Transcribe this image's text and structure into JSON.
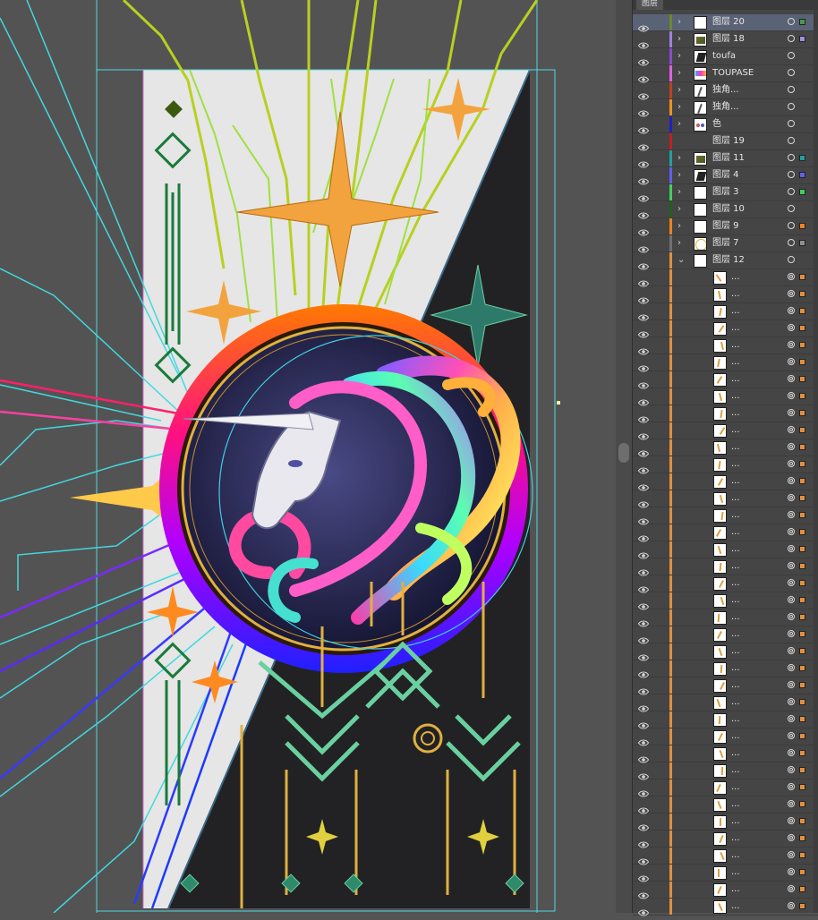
{
  "panel": {
    "tab_label": "图层"
  },
  "layers": [
    {
      "name": "图层 20",
      "color": "#6a8a2a",
      "expandable": true,
      "selected": true,
      "thumb": "white",
      "target": "single",
      "selbox": "#4a9a4a"
    },
    {
      "name": "图层 18",
      "color": "#a080e0",
      "expandable": true,
      "selected": false,
      "thumb": "art",
      "target": "single",
      "selbox": "#a090e0"
    },
    {
      "name": "toufa",
      "color": "#8a4ad0",
      "expandable": true,
      "selected": false,
      "thumb": "dark",
      "target": "single",
      "selbox": ""
    },
    {
      "name": "TOUPASE",
      "color": "#e060e0",
      "expandable": true,
      "selected": false,
      "thumb": "rainbow",
      "target": "single",
      "selbox": ""
    },
    {
      "name": "独角...",
      "color": "#c04020",
      "expandable": true,
      "selected": false,
      "thumb": "sketch",
      "target": "single",
      "selbox": ""
    },
    {
      "name": "独角...",
      "color": "#f09020",
      "expandable": true,
      "selected": false,
      "thumb": "sketch",
      "target": "single",
      "selbox": ""
    },
    {
      "name": "色",
      "color": "#2020c0",
      "expandable": true,
      "selected": false,
      "thumb": "dots",
      "target": "single",
      "selbox": ""
    },
    {
      "name": "图层 19",
      "color": "#c02020",
      "expandable": false,
      "selected": false,
      "thumb": "none",
      "target": "single",
      "selbox": ""
    },
    {
      "name": "图层 11",
      "color": "#20a0a0",
      "expandable": true,
      "selected": false,
      "thumb": "art",
      "target": "single",
      "selbox": "#20a0a0"
    },
    {
      "name": "图层 4",
      "color": "#6060f0",
      "expandable": true,
      "selected": false,
      "thumb": "dark",
      "target": "single",
      "selbox": "#6060f0"
    },
    {
      "name": "图层 3",
      "color": "#40d060",
      "expandable": true,
      "selected": false,
      "thumb": "white",
      "target": "single",
      "selbox": "#40d060"
    },
    {
      "name": "图层 10",
      "color": "#206020",
      "expandable": true,
      "selected": false,
      "thumb": "white",
      "target": "single",
      "selbox": ""
    },
    {
      "name": "图层 9",
      "color": "#f08020",
      "expandable": true,
      "selected": false,
      "thumb": "white",
      "target": "single",
      "selbox": "#f08020"
    },
    {
      "name": "图层 7",
      "color": "#707070",
      "expandable": true,
      "selected": false,
      "thumb": "circle",
      "target": "single",
      "selbox": "#909090"
    },
    {
      "name": "图层 12",
      "color": "#e09040",
      "expandable": true,
      "expanded": true,
      "selected": false,
      "thumb": "white",
      "target": "single",
      "selbox": ""
    }
  ],
  "sublayers": {
    "label": "...",
    "count": 38,
    "color": "#e09040",
    "selbox": "#e09040"
  }
}
